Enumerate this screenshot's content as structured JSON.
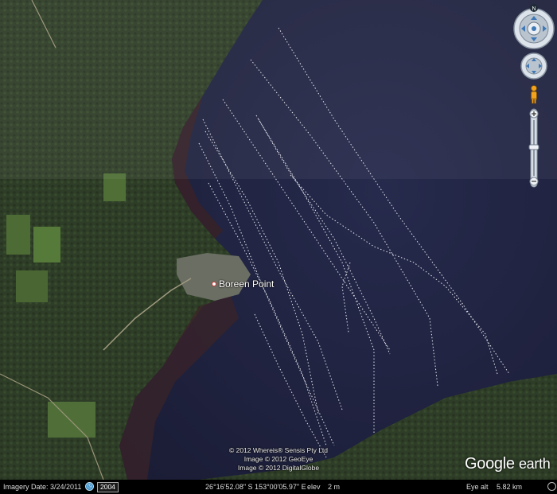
{
  "map": {
    "place_label": "Boreen Point",
    "attribution": [
      "© 2012 Whereis® Sensis Pty Ltd",
      "Image © 2012 GeoEye",
      "Image © 2012 DigitalGlobe"
    ],
    "logo": {
      "brand": "Google",
      "product": "earth"
    },
    "colors": {
      "water": "#1f2241",
      "land": "#2c3a25",
      "track": "#e8e8f0"
    }
  },
  "navigation": {
    "north_label": "N",
    "icons": [
      "look-joystick-icon",
      "move-joystick-icon",
      "street-view-pegman-icon",
      "zoom-in-icon",
      "zoom-out-icon"
    ]
  },
  "statusbar": {
    "imagery_date": "Imagery Date: 3/24/2011",
    "year_badge": "2004",
    "coordinates": "26°16'52.08\" S 153°00'05.97\" E",
    "elev_label": "elev",
    "elev_value": "2 m",
    "eye_alt_label": "Eye alt",
    "eye_alt_value": "5.82 km"
  }
}
